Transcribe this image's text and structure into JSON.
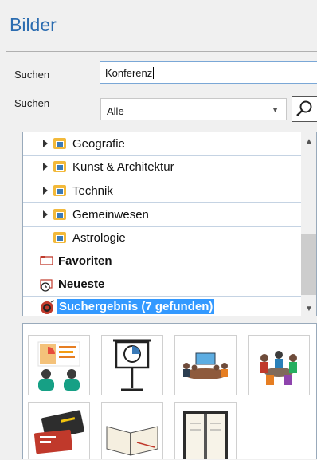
{
  "header": {
    "title": "Bilder"
  },
  "search": {
    "label1": "Suchen",
    "query": "Konferenz",
    "label2": "Suchen",
    "filter_value": "Alle",
    "search_button_icon": "magnifier-icon"
  },
  "tree": {
    "items": [
      {
        "label": "Geografie",
        "expandable": true
      },
      {
        "label": "Kunst & Architektur",
        "expandable": true
      },
      {
        "label": "Technik",
        "expandable": true
      },
      {
        "label": "Gemeinwesen",
        "expandable": true
      },
      {
        "label": "Astrologie",
        "expandable": false
      },
      {
        "label": "Favoriten",
        "bold": true
      },
      {
        "label": "Neueste",
        "bold": true
      },
      {
        "label": "Suchergebnis (7 gefunden)",
        "bold": true,
        "selected": true
      }
    ]
  },
  "results": {
    "thumbnails": [
      "presentation-people-thumbnail",
      "projector-screen-thumbnail",
      "meeting-table-thumbnail",
      "team-discussion-thumbnail",
      "business-cards-thumbnail",
      "open-notebook-thumbnail",
      "agenda-book-thumbnail"
    ]
  },
  "colors": {
    "accent": "#2b6cb0",
    "selection": "#3399ff",
    "folder": "#f2b93b"
  }
}
